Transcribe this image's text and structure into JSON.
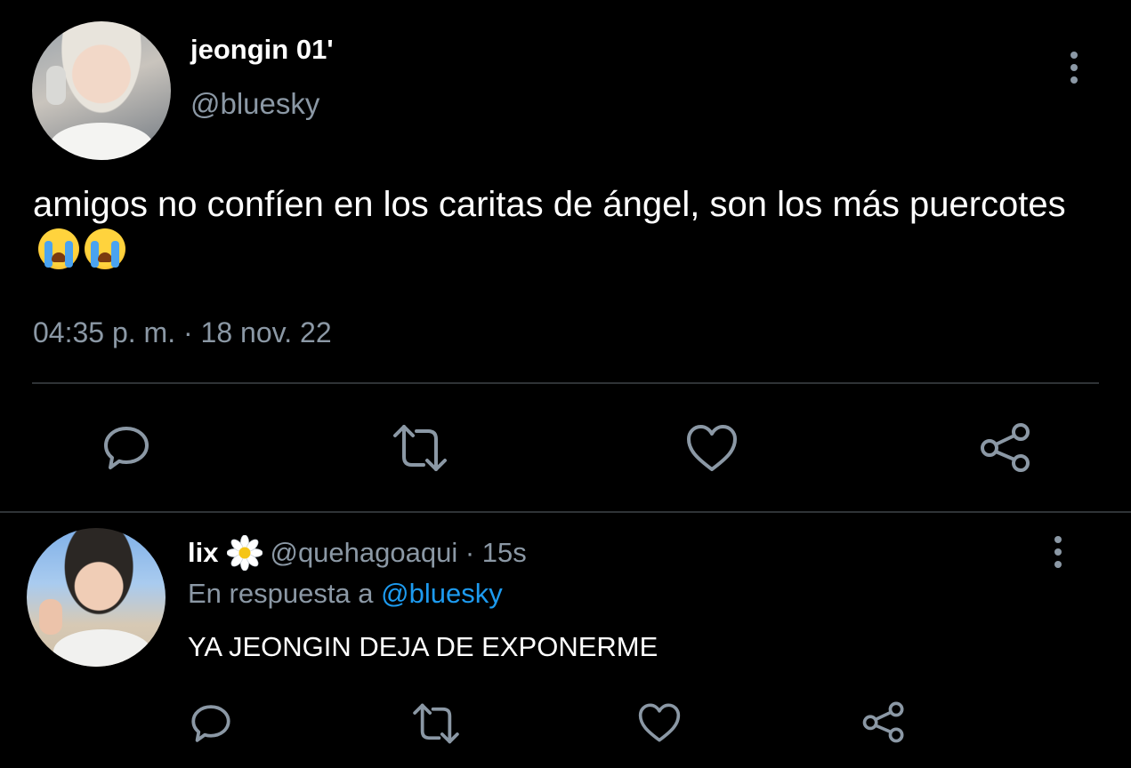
{
  "main_tweet": {
    "display_name": "jeongin 01'",
    "handle": "@bluesky",
    "text": "amigos no confíen en los caritas de ángel, son los más puercotes",
    "emojis": [
      "loudly-crying-face",
      "loudly-crying-face"
    ],
    "time": "04:35 p. m.",
    "separator": " · ",
    "date": "18 nov. 22",
    "actions": [
      "reply-icon",
      "retweet-icon",
      "like-icon",
      "share-icon"
    ]
  },
  "reply_tweet": {
    "display_name": "lix",
    "badge_icon": "daisy-icon",
    "handle_and_time": "@quehagoaqui · 15s",
    "replying_to_label": "En respuesta a ",
    "replying_to_handle": "@bluesky",
    "text": "YA JEONGIN DEJA DE EXPONERME",
    "actions": [
      "reply-icon",
      "retweet-icon",
      "like-icon",
      "share-icon"
    ]
  },
  "colors": {
    "background": "#000000",
    "primary_text": "#ffffff",
    "secondary_text": "#8b98a5",
    "accent": "#1d9bf0",
    "divider": "#2f3336"
  }
}
